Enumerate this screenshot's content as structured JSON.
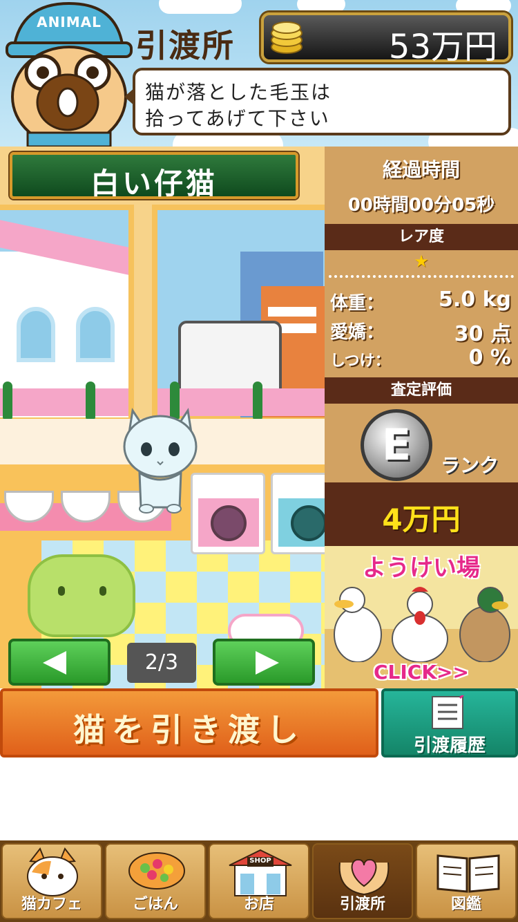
{
  "header": {
    "title": "引渡所",
    "money": "53万円",
    "cap_text": "ANIMAL",
    "speech": [
      "猫が落とした毛玉は",
      "拾ってあげて下さい"
    ]
  },
  "cat": {
    "name": "白い仔猫",
    "page": "2/3"
  },
  "info": {
    "elapsed_label": "経過時間",
    "elapsed_value": "00時間00分05秒",
    "rarity_label": "レア度",
    "rarity_stars": "★",
    "stats": [
      {
        "label": "体重：",
        "value": "5.0 kg"
      },
      {
        "label": "愛嬌：",
        "value": "30 点"
      },
      {
        "label": "しつけ：",
        "value": "0 %"
      }
    ],
    "assessment_label": "査定評価",
    "rank_letter": "E",
    "rank_label": "ランク",
    "price": "4万円"
  },
  "ad": {
    "title": "ようけい場",
    "cta": "CLICK>>"
  },
  "actions": {
    "handover": "猫を引き渡し",
    "history": "引渡履歴"
  },
  "tabs": [
    {
      "label": "猫カフェ",
      "icon": "cat-face-icon"
    },
    {
      "label": "ごはん",
      "icon": "food-bowl-icon"
    },
    {
      "label": "お店",
      "icon": "shop-icon",
      "sign": "SHOP"
    },
    {
      "label": "引渡所",
      "icon": "heart-hands-icon",
      "active": true
    },
    {
      "label": "図鑑",
      "icon": "book-icon"
    }
  ]
}
